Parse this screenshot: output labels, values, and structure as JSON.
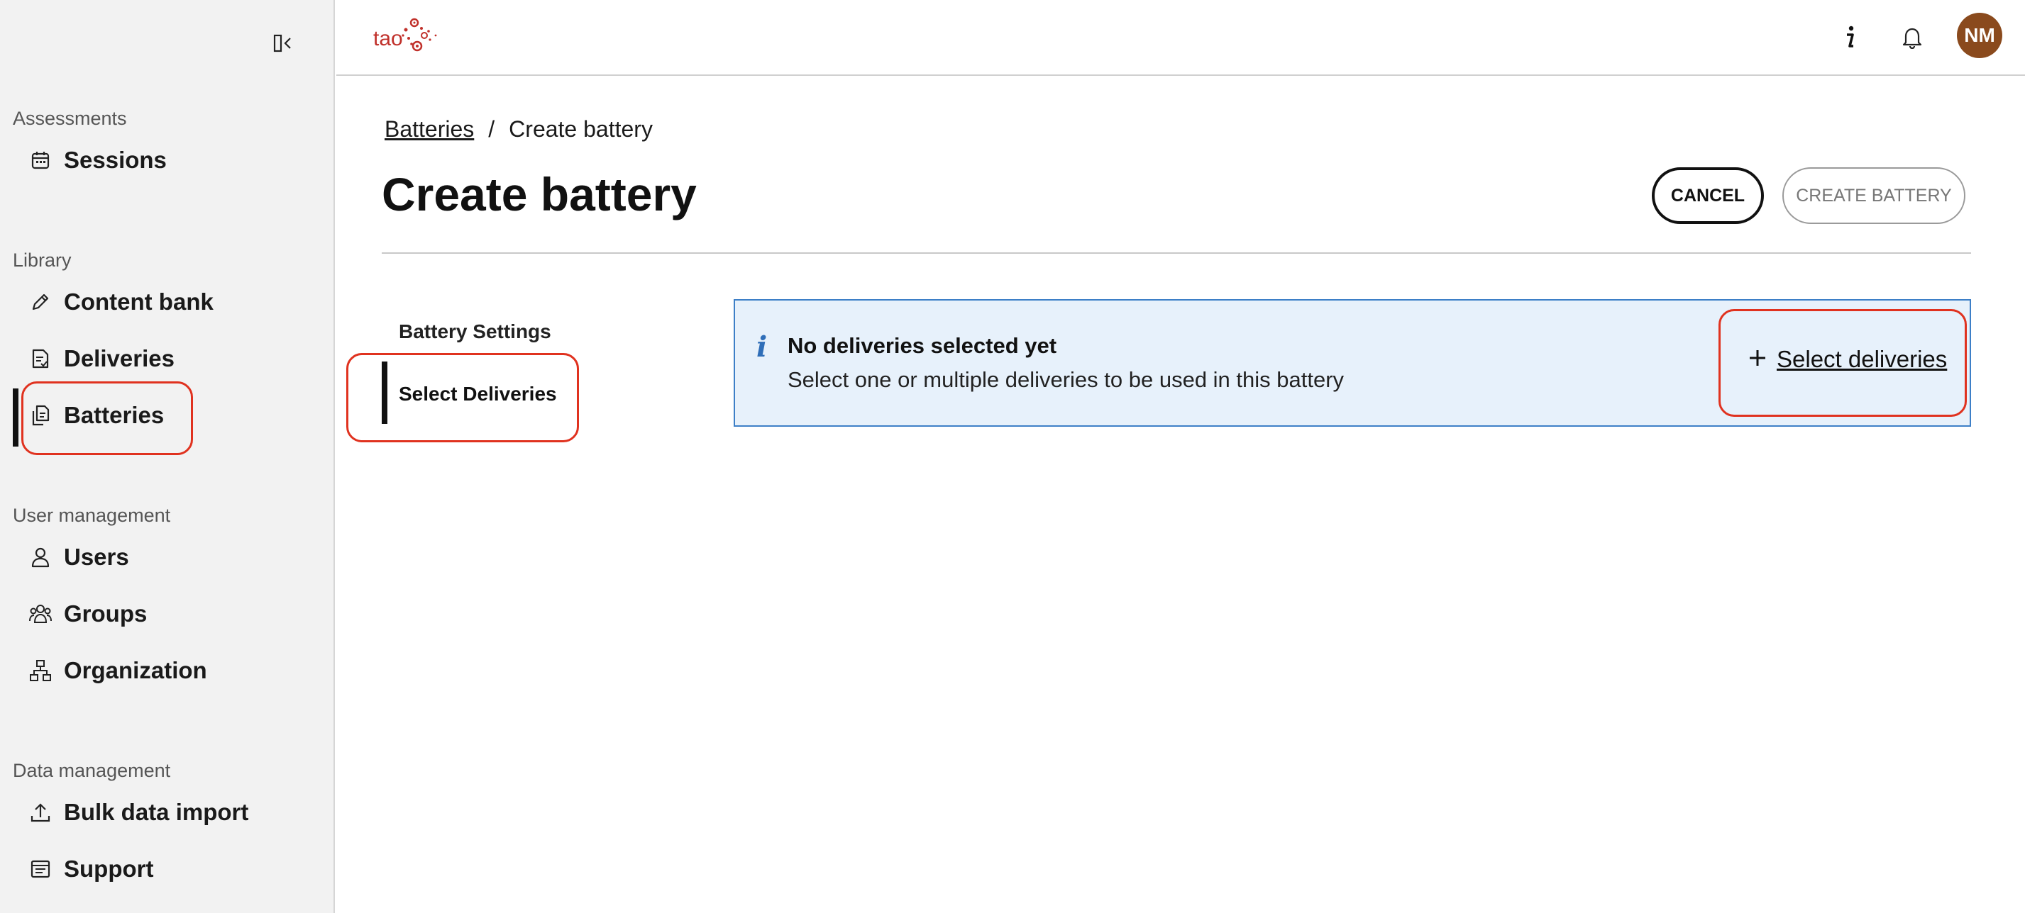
{
  "sidebar": {
    "sections": [
      {
        "title": "Assessments",
        "items": [
          {
            "label": "Sessions",
            "icon": "calendar-icon"
          }
        ]
      },
      {
        "title": "Library",
        "items": [
          {
            "label": "Content bank",
            "icon": "pencil-icon"
          },
          {
            "label": "Deliveries",
            "icon": "delivery-doc-icon"
          },
          {
            "label": "Batteries",
            "icon": "batteries-doc-icon"
          }
        ]
      },
      {
        "title": "User management",
        "items": [
          {
            "label": "Users",
            "icon": "user-icon"
          },
          {
            "label": "Groups",
            "icon": "groups-icon"
          },
          {
            "label": "Organization",
            "icon": "org-chart-icon"
          }
        ]
      },
      {
        "title": "Data management",
        "items": [
          {
            "label": "Bulk data import",
            "icon": "upload-icon"
          },
          {
            "label": "Support",
            "icon": "support-icon"
          }
        ]
      }
    ],
    "active_item": "Batteries"
  },
  "header": {
    "logo_text": "tao",
    "avatar_initials": "NM",
    "accent_color": "#c0302a",
    "avatar_color": "#8a4a1d"
  },
  "breadcrumb": {
    "parent": "Batteries",
    "separator": "/",
    "current": "Create battery"
  },
  "page": {
    "title": "Create battery",
    "cancel_label": "CANCEL",
    "create_label": "CREATE BATTERY"
  },
  "steps": {
    "title": "Battery Settings",
    "active": "Select Deliveries"
  },
  "info": {
    "icon": "i",
    "title": "No deliveries selected yet",
    "description": "Select one or multiple deliveries to be used in this battery",
    "action_label": "Select deliveries"
  }
}
